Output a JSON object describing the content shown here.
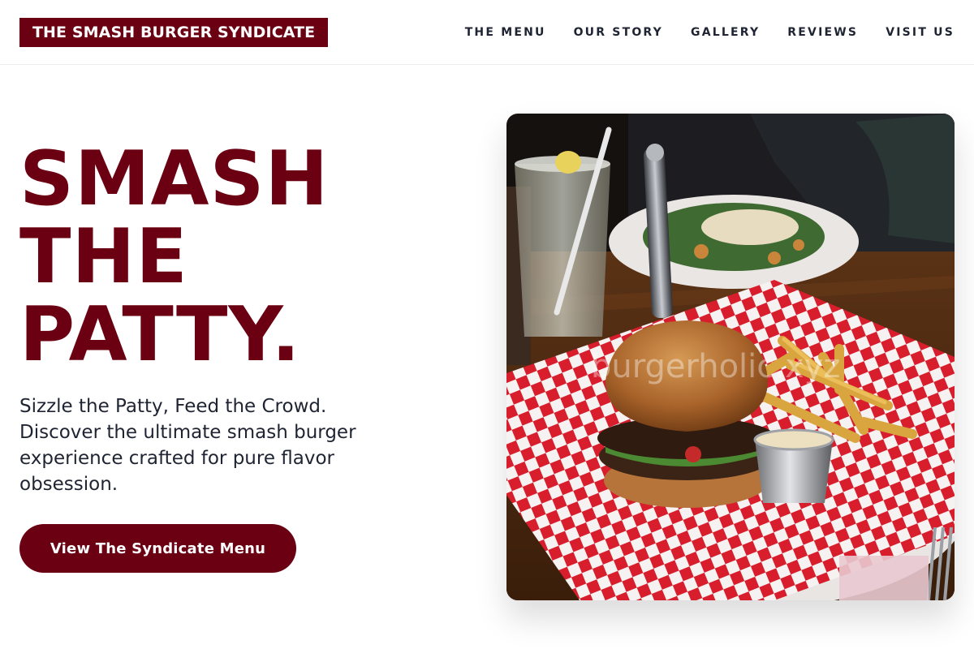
{
  "header": {
    "logo_text": "THE SMASH BURGER SYNDICATE",
    "nav": [
      {
        "label": "THE MENU"
      },
      {
        "label": "OUR STORY"
      },
      {
        "label": "GALLERY"
      },
      {
        "label": "REVIEWS"
      },
      {
        "label": "VISIT US"
      }
    ]
  },
  "hero": {
    "headline_lines": [
      "SMASH",
      "THE",
      "PATTY."
    ],
    "tagline": "Sizzle the Patty, Feed the Crowd. Discover the ultimate smash burger experience crafted for pure flavor obsession.",
    "cta_label": "View The Syndicate Menu",
    "image_watermark": "burgerholic.xyz"
  },
  "colors": {
    "brand": "#6b0012",
    "text": "#1f2433",
    "background": "#ffffff"
  }
}
